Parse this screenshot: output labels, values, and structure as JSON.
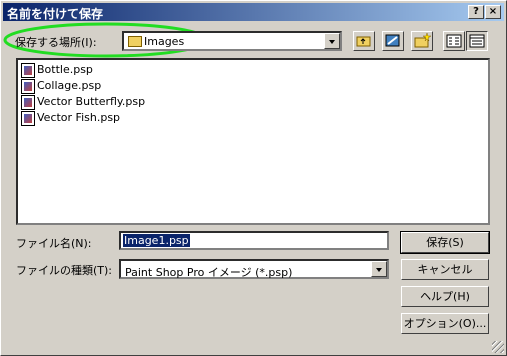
{
  "window": {
    "title": "名前を付けて保存"
  },
  "titlebar": {
    "help_btn": "?",
    "close_btn": "×"
  },
  "location": {
    "label": "保存する場所(I):",
    "value": "Images"
  },
  "files": [
    {
      "name": "Bottle.psp"
    },
    {
      "name": "Collage.psp"
    },
    {
      "name": "Vector Butterfly.psp"
    },
    {
      "name": "Vector Fish.psp"
    }
  ],
  "filename": {
    "label": "ファイル名(N):",
    "value": "Image1.psp"
  },
  "filetype": {
    "label": "ファイルの種類(T):",
    "value": "Paint Shop Pro イメージ (*.psp)"
  },
  "buttons": {
    "save": "保存(S)",
    "cancel": "キャンセル",
    "help": "ヘルプ(H)",
    "options": "オプション(O)..."
  },
  "colors": {
    "highlight_ring": "#22dd22",
    "title_start": "#0a246a",
    "title_end": "#a6caf0"
  }
}
